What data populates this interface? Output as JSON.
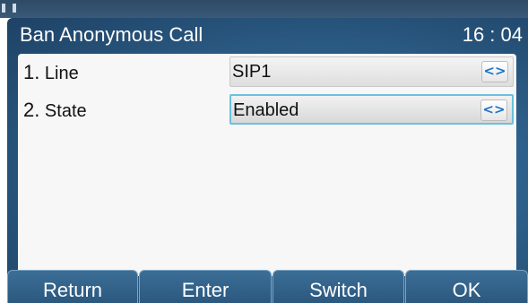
{
  "screen": {
    "title": "Ban Anonymous Call",
    "clock": "16 : 04"
  },
  "rows": [
    {
      "number": "1.",
      "label": "Line",
      "value": "SIP1",
      "selected": false
    },
    {
      "number": "2.",
      "label": "State",
      "value": "Enabled",
      "selected": true
    }
  ],
  "arrow_glyph": "<>",
  "softkeys": [
    "Return",
    "Enter",
    "Switch",
    "OK"
  ],
  "colors": {
    "panel": "#2f6590",
    "selection_border": "#6ac0e0",
    "arrow": "#1a73c8"
  }
}
